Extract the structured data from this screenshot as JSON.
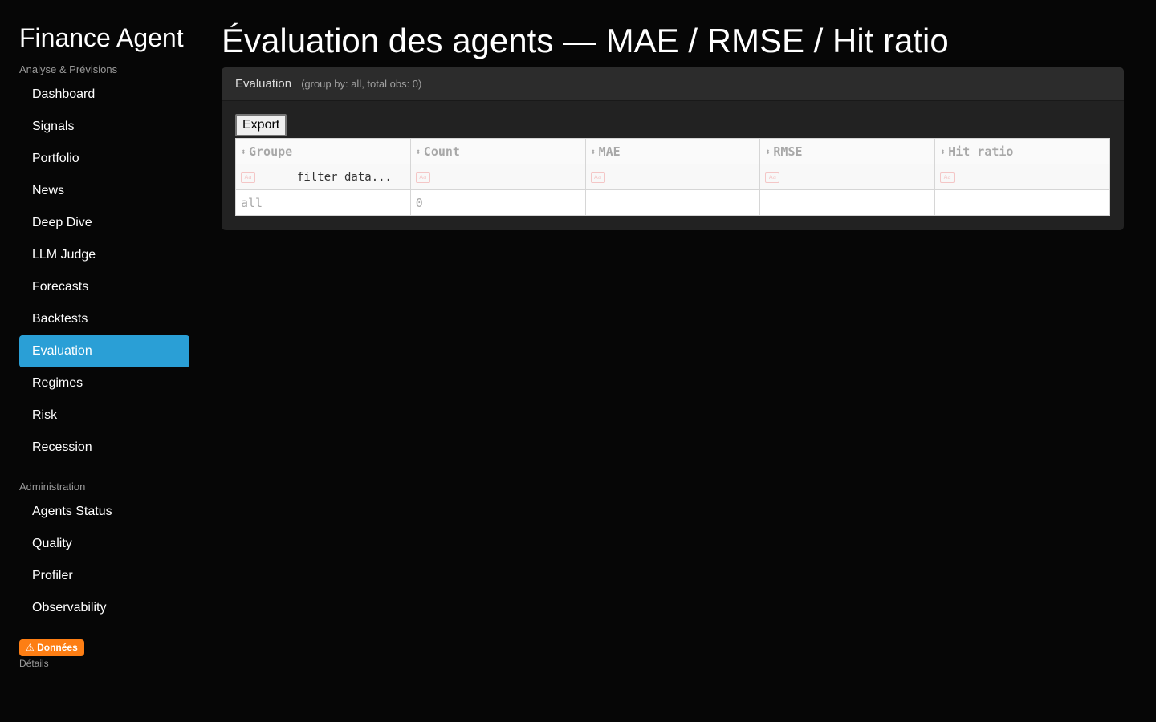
{
  "sidebar": {
    "app_title": "Finance Agent",
    "sections": [
      {
        "label": "Analyse & Prévisions",
        "items": [
          {
            "label": "Dashboard",
            "active": false
          },
          {
            "label": "Signals",
            "active": false
          },
          {
            "label": "Portfolio",
            "active": false
          },
          {
            "label": "News",
            "active": false
          },
          {
            "label": "Deep Dive",
            "active": false
          },
          {
            "label": "LLM Judge",
            "active": false
          },
          {
            "label": "Forecasts",
            "active": false
          },
          {
            "label": "Backtests",
            "active": false
          },
          {
            "label": "Evaluation",
            "active": true
          },
          {
            "label": "Regimes",
            "active": false
          },
          {
            "label": "Risk",
            "active": false
          },
          {
            "label": "Recession",
            "active": false
          }
        ]
      },
      {
        "label": "Administration",
        "items": [
          {
            "label": "Agents Status",
            "active": false
          },
          {
            "label": "Quality",
            "active": false
          },
          {
            "label": "Profiler",
            "active": false
          },
          {
            "label": "Observability",
            "active": false
          }
        ]
      }
    ],
    "badge_label": "⚠ Données",
    "details_label": "Détails",
    "active_color": "#2a9fd6",
    "badge_color": "#fd7e14"
  },
  "main": {
    "page_title": "Évaluation des agents — MAE / RMSE / Hit ratio",
    "card": {
      "title": "Evaluation",
      "subtitle": "(group by: all, total obs: 0)",
      "export_label": "Export",
      "table": {
        "columns": [
          "Groupe",
          "Count",
          "MAE",
          "RMSE",
          "Hit ratio"
        ],
        "sort_icon": "⬍",
        "case_icon": "Aa",
        "filter_placeholder": "filter data...",
        "rows": [
          [
            "all",
            "0",
            "",
            "",
            ""
          ]
        ]
      }
    }
  }
}
